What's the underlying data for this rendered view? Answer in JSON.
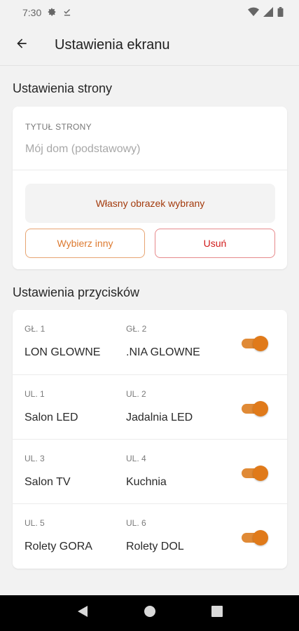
{
  "status": {
    "time": "7:30"
  },
  "app_bar": {
    "title": "Ustawienia ekranu"
  },
  "page_settings": {
    "section_title": "Ustawienia strony",
    "field_label": "TYTUŁ STRONY",
    "field_placeholder": "Mój dom (podstawowy)",
    "image_status": "Własny obrazek wybrany",
    "choose_other_label": "Wybierz inny",
    "remove_label": "Usuń"
  },
  "button_settings": {
    "section_title": "Ustawienia przycisków",
    "rows": [
      {
        "left_label": "GŁ. 1",
        "left_value": "LON GLOWNE",
        "right_label": "GŁ. 2",
        "right_value": ".NIA GLOWNE",
        "enabled": true
      },
      {
        "left_label": "UL. 1",
        "left_value": "Salon LED",
        "right_label": "UL. 2",
        "right_value": "Jadalnia LED",
        "enabled": true
      },
      {
        "left_label": "UL. 3",
        "left_value": "Salon TV",
        "right_label": "UL. 4",
        "right_value": "Kuchnia",
        "enabled": true
      },
      {
        "left_label": "UL. 5",
        "left_value": "Rolety GORA",
        "right_label": "UL. 6",
        "right_value": "Rolety DOL",
        "enabled": true
      }
    ]
  },
  "colors": {
    "accent": "#e07a1a",
    "accent_text": "#dd7a30",
    "danger": "#d11a1a",
    "image_status_text": "#a33a0c"
  },
  "icons": {
    "status": [
      "settings-icon",
      "download-done-icon",
      "wifi-icon",
      "signal-icon",
      "battery-icon"
    ],
    "nav": [
      "back-triangle-icon",
      "home-circle-icon",
      "recents-square-icon"
    ]
  }
}
